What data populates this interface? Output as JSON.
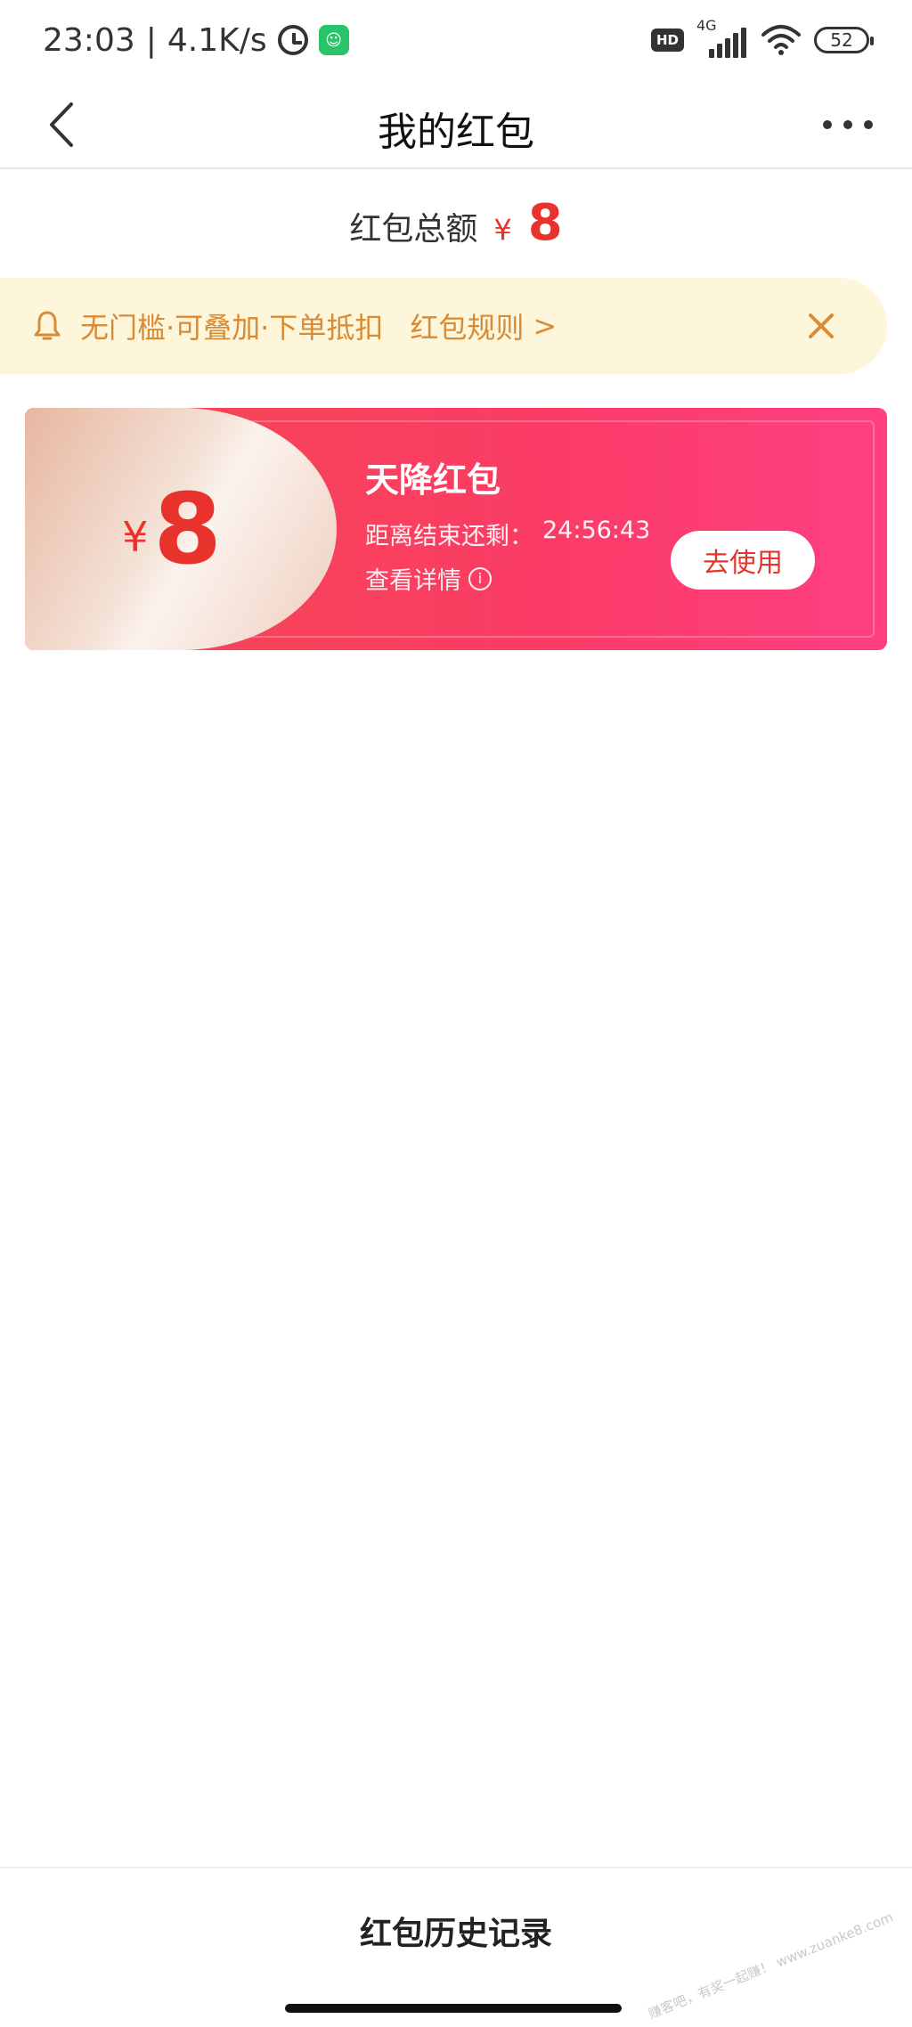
{
  "status_bar": {
    "time": "23:03",
    "separator": "|",
    "speed": "4.1K/s",
    "hd": "HD",
    "network": "4G",
    "battery": "52"
  },
  "header": {
    "title": "我的红包"
  },
  "total": {
    "label": "红包总额",
    "currency": "¥",
    "amount": "8"
  },
  "notice": {
    "text": "无门槛·可叠加·下单抵扣",
    "rules_link": "红包规则",
    "rules_arrow": ">"
  },
  "coupon": {
    "currency": "¥",
    "amount": "8",
    "title": "天降红包",
    "countdown_label": "距离结束还剩：",
    "countdown_value": "24:56:43",
    "details_label": "查看详情",
    "info_glyph": "i",
    "use_button": "去使用"
  },
  "footer": {
    "history_link": "红包历史记录"
  },
  "watermark": "赚客吧，有奖一起赚！ www.zuanke8.com",
  "colors": {
    "accent_red": "#e8332d",
    "notice_bg": "#fdf6db",
    "notice_text": "#d98a35",
    "card_gradient_start": "#f5484e",
    "card_gradient_end": "#ff3f82"
  }
}
